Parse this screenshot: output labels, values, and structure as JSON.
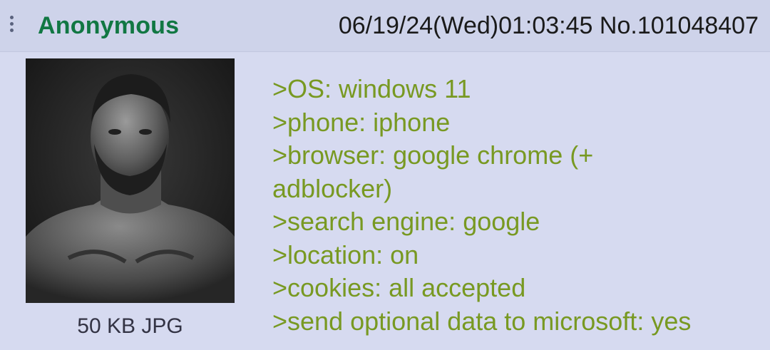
{
  "post": {
    "author": "Anonymous",
    "datetime": "06/19/24(Wed)01:03:45",
    "number": "No.101048407",
    "file_info": "50 KB JPG",
    "lines": [
      ">OS: windows 11",
      ">phone: iphone",
      ">browser: google chrome (+",
      "adblocker)",
      ">search engine: google",
      ">location: on",
      ">cookies: all accepted",
      ">send optional data to microsoft: yes"
    ]
  },
  "colors": {
    "background": "#d6daf0",
    "header": "#ced3ea",
    "name": "#117743",
    "greentext": "#789922"
  },
  "icons": {
    "menu": "vertical-dots-icon"
  }
}
